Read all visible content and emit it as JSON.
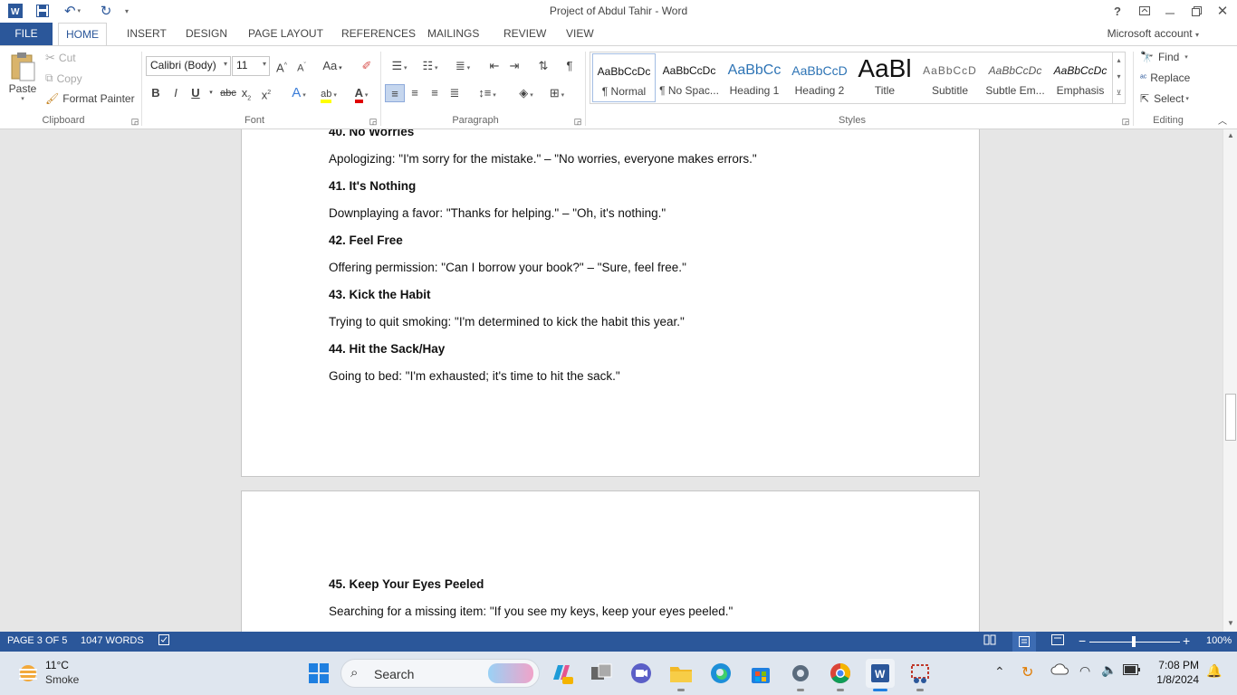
{
  "window": {
    "title": "Project of Abdul Tahir - Word",
    "help": "?",
    "account": "Microsoft account"
  },
  "tabs": [
    "FILE",
    "HOME",
    "INSERT",
    "DESIGN",
    "PAGE LAYOUT",
    "REFERENCES",
    "MAILINGS",
    "REVIEW",
    "VIEW"
  ],
  "active_tab": "HOME",
  "clipboard": {
    "paste": "Paste",
    "cut": "Cut",
    "copy": "Copy",
    "format_painter": "Format Painter",
    "label": "Clipboard"
  },
  "font": {
    "family": "Calibri (Body)",
    "size": "11",
    "label": "Font",
    "bold": "B",
    "italic": "I",
    "underline": "U",
    "strike": "abc",
    "change_case": "Aa"
  },
  "paragraph": {
    "label": "Paragraph"
  },
  "styles": {
    "label": "Styles",
    "items": [
      {
        "preview": "AaBbCcDc",
        "name": "¶ Normal"
      },
      {
        "preview": "AaBbCcDc",
        "name": "¶ No Spac..."
      },
      {
        "preview": "AaBbCc",
        "name": "Heading 1"
      },
      {
        "preview": "AaBbCcD",
        "name": "Heading 2"
      },
      {
        "preview": "AaBl",
        "name": "Title"
      },
      {
        "preview": "AaBbCcD",
        "name": "Subtitle"
      },
      {
        "preview": "AaBbCcDc",
        "name": "Subtle Em..."
      },
      {
        "preview": "AaBbCcDc",
        "name": "Emphasis"
      }
    ]
  },
  "editing": {
    "find": "Find",
    "replace": "Replace",
    "select": "Select",
    "label": "Editing"
  },
  "document": {
    "page1": [
      {
        "text": "40. No Worries",
        "bold": true
      },
      {
        "text": "Apologizing: \"I'm sorry for the mistake.\" – \"No worries, everyone makes errors.\"",
        "bold": false
      },
      {
        "text": "41. It's Nothing",
        "bold": true
      },
      {
        "text": "Downplaying a favor: \"Thanks for helping.\" – \"Oh, it's nothing.\"",
        "bold": false
      },
      {
        "text": "42. Feel Free",
        "bold": true
      },
      {
        "text": "Offering permission: \"Can I borrow your book?\" – \"Sure, feel free.\"",
        "bold": false
      },
      {
        "text": "43. Kick the Habit",
        "bold": true
      },
      {
        "text": "Trying to quit smoking: \"I'm determined to kick the habit this year.\"",
        "bold": false
      },
      {
        "text": "44. Hit the Sack/Hay",
        "bold": true
      },
      {
        "text": "Going to bed: \"I'm exhausted; it's time to hit the sack.\"",
        "bold": false
      }
    ],
    "page2": [
      {
        "text": "45. Keep Your Eyes Peeled",
        "bold": true
      },
      {
        "text": "Searching for a missing item: \"If you see my keys, keep your eyes peeled.\"",
        "bold": false
      }
    ]
  },
  "status": {
    "page": "PAGE 3 OF 5",
    "words": "1047 WORDS",
    "zoom": "100%",
    "zoom_minus": "−",
    "zoom_plus": "+"
  },
  "taskbar": {
    "weather_temp": "11°C",
    "weather_desc": "Smoke",
    "search": "Search",
    "time": "7:08 PM",
    "date": "1/8/2024"
  },
  "colors": {
    "word_blue": "#2b579a",
    "taskbar_bg": "#dfe6ef"
  }
}
